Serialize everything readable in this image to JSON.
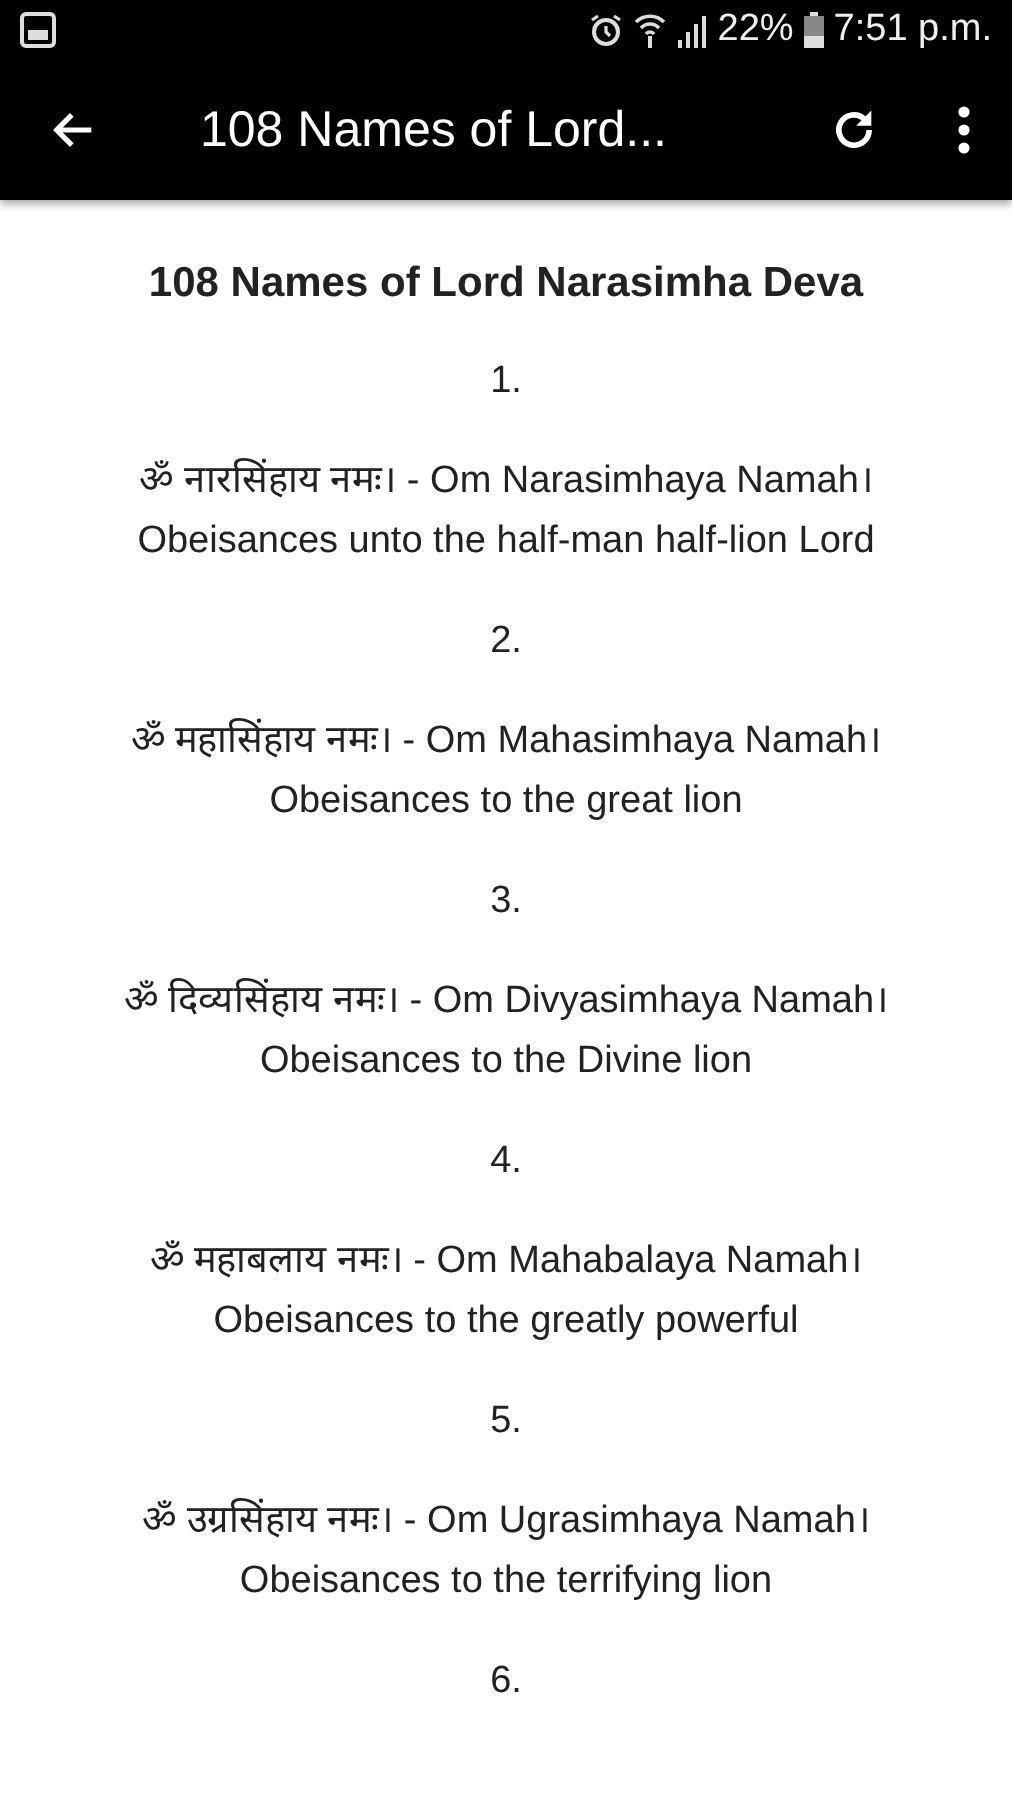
{
  "status_bar": {
    "battery": "22%",
    "time": "7:51 p.m."
  },
  "app_bar": {
    "title": "108 Names of Lord..."
  },
  "content": {
    "heading": "108 Names of Lord Narasimha Deva",
    "entries": [
      {
        "number": "1.",
        "mantra": "ॐ नारसिंहाय नमः। - Om Narasimhaya Namah।",
        "meaning": "Obeisances unto the half-man half-lion Lord"
      },
      {
        "number": "2.",
        "mantra": "ॐ महासिंहाय नमः। - Om Mahasimhaya Namah।",
        "meaning": "Obeisances to the great lion"
      },
      {
        "number": "3.",
        "mantra": "ॐ दिव्यसिंहाय नमः। - Om Divyasimhaya Namah।",
        "meaning": "Obeisances to the Divine lion"
      },
      {
        "number": "4.",
        "mantra": "ॐ महाबलाय नमः। - Om Mahabalaya Namah।",
        "meaning": "Obeisances to the greatly powerful"
      },
      {
        "number": "5.",
        "mantra": "ॐ उग्रसिंहाय नमः। - Om Ugrasimhaya Namah।",
        "meaning": "Obeisances to the terrifying lion"
      },
      {
        "number": "6."
      }
    ]
  }
}
